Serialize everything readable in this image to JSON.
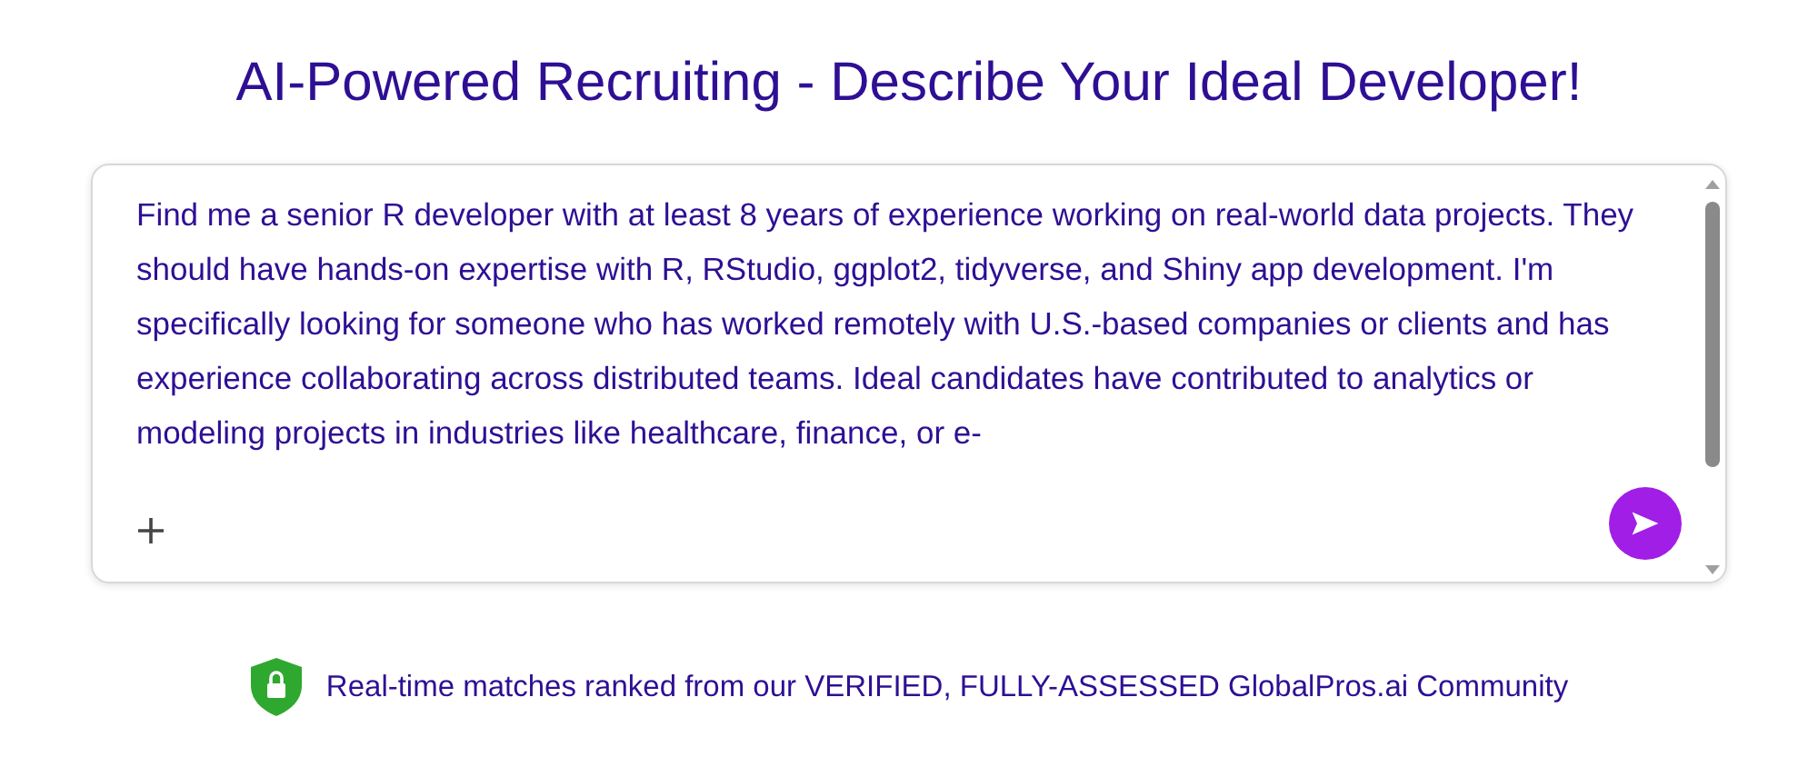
{
  "title": "AI-Powered Recruiting - Describe Your Ideal Developer!",
  "prompt": {
    "value": "Find me a senior R developer with at least 8 years of experience working on real-world data projects. They should have hands-on expertise with R, RStudio, ggplot2, tidyverse, and Shiny app development. I'm specifically looking for someone who has worked remotely with U.S.-based companies or clients and has experience collaborating across distributed teams. Ideal candidates have contributed to analytics or modeling projects in industries like healthcare, finance, or e-"
  },
  "footer_note": "Real-time matches ranked from our VERIFIED, FULLY-ASSESSED GlobalPros.ai Community"
}
